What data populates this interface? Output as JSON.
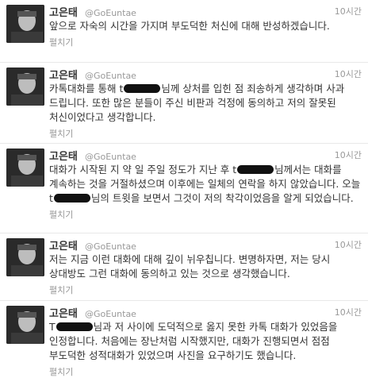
{
  "user": {
    "name": "고은태",
    "handle": "@GoEuntae"
  },
  "expand_label": "펼치기",
  "tweets": [
    {
      "time": "10시간",
      "text": "앞으로 자숙의 시간을 가지며 부도덕한 처신에 대해 반성하겠습니다."
    },
    {
      "time": "10시간",
      "text_1": "카톡대화를 통해 t",
      "text_2": "님께 상처를 입힌 점 죄송하게 생각하며 사과 드립니다. 또한 많은 분들이 주신 비판과 걱정에 동의하고 저의 잘못된 처신이었다고 생각합니다."
    },
    {
      "time": "10시간",
      "text_1": "대화가 시작된 지 약 일 주일 정도가 지난 후 t",
      "text_2": "님께서는 대화를 계속하는 것을 거절하셨으며 이후에는 일체의 연락을 하지 않았습니다. 오늘 t",
      "text_3": "님의 트윗을 보면서 그것이 저의 착각이었음을 알게 되었습니다."
    },
    {
      "time": "10시간",
      "text": "저는 지금 이런 대화에 대해 깊이 뉘우칩니다. 변명하자면, 저는 당시 상대방도 그런 대화에 동의하고 있는 것으로 생각했습니다."
    },
    {
      "time": "10시간",
      "text_1": "T",
      "text_2": "님과 저 사이에 도덕적으로 옳지 못한 카톡 대화가 있었음을 인정합니다. 처음에는 장난처럼 시작했지만, 대화가 진행되면서 점점 부도덕한 성적대화가 있었으며 사진을 요구하기도 했습니다."
    }
  ]
}
